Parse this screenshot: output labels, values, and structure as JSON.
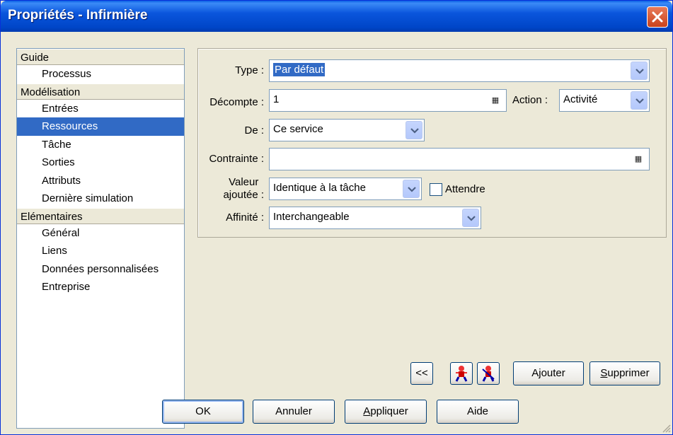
{
  "window": {
    "title": "Propriétés - Infirmière"
  },
  "nav": {
    "groups": [
      {
        "label": "Guide",
        "items": [
          "Processus"
        ]
      },
      {
        "label": "Modélisation",
        "items": [
          "Entrées",
          "Ressources",
          "Tâche",
          "Sorties",
          "Attributs",
          "Dernière simulation"
        ]
      },
      {
        "label": "Elémentaires",
        "items": [
          "Général",
          "Liens",
          "Données personnalisées",
          "Entreprise"
        ]
      }
    ],
    "selected": "Ressources"
  },
  "form": {
    "type_label": "Type :",
    "type_value": "Par défaut",
    "decompte_label": "Décompte :",
    "decompte_value": "1",
    "action_label": "Action :",
    "action_value": "Activité",
    "de_label": "De :",
    "de_value": "Ce service",
    "contrainte_label": "Contrainte :",
    "contrainte_value": "",
    "valeur_label_1": "Valeur",
    "valeur_label_2": "ajoutée :",
    "valeur_value": "Identique à la tâche",
    "attendre_label": "Attendre",
    "attendre_checked": false,
    "affinite_label": "Affinité :",
    "affinite_value": "Interchangeable"
  },
  "panel_buttons": {
    "back": "<<",
    "ajouter_pre": "A",
    "ajouter_u": "j",
    "ajouter_post": "outer",
    "supprimer_u": "S",
    "supprimer_post": "upprimer"
  },
  "dialog_buttons": {
    "ok": "OK",
    "annuler": "Annuler",
    "appliquer_u": "A",
    "appliquer_post": "ppliquer",
    "aide": "Aide"
  },
  "icons": {
    "close": "close-icon",
    "dropdown": "chevron-down-icon",
    "calculator": "calculator-icon",
    "person_add": "person-add-icon",
    "person_remove": "person-remove-icon",
    "resize": "resize-grip-icon"
  },
  "colors": {
    "selection": "#316ac5",
    "titlebar": "#0a55dc",
    "dialog_bg": "#ece9d8"
  }
}
